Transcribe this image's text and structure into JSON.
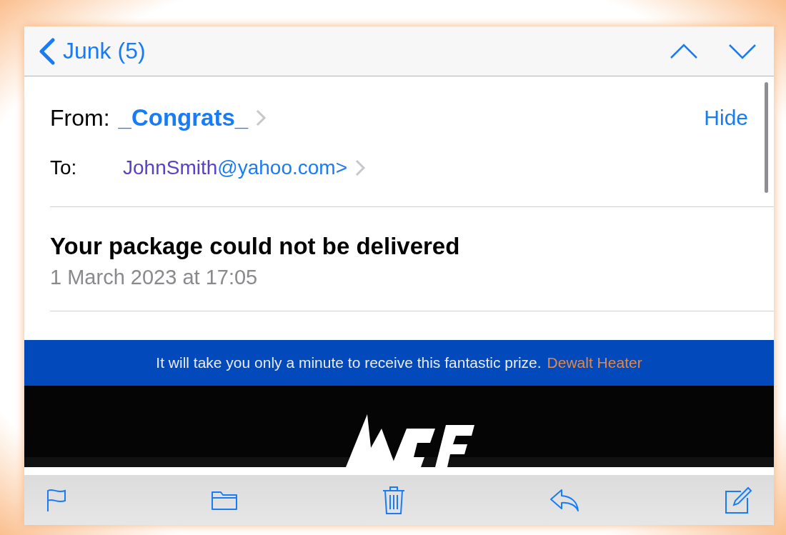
{
  "nav": {
    "back_label": "Junk (5)"
  },
  "header": {
    "from_label": "From:",
    "sender": "_Congrats_",
    "hide_label": "Hide",
    "to_label": "To:",
    "address_parts": [
      {
        "text": "JohnSmith",
        "kind": "display"
      },
      {
        "text": "@yahoo.com>",
        "kind": "link"
      }
    ]
  },
  "subject": "Your package could not be delivered",
  "date": "1 March 2023 at 17:05",
  "banner": {
    "text": "It will take you only a minute to receive this fantastic prize.",
    "link": "Dewalt Heater"
  }
}
